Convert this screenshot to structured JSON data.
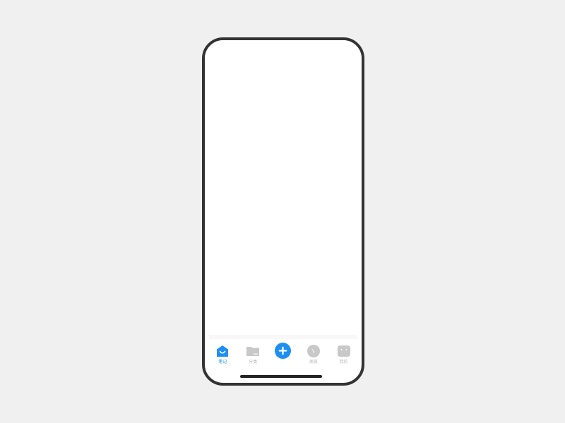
{
  "colors": {
    "background": "#f0f0f0",
    "phone_frame": "#333333",
    "screen": "#ffffff",
    "accent": "#1e8ff2",
    "inactive": "#c8c8c8",
    "home_indicator": "#222222"
  },
  "tabbar": {
    "items": [
      {
        "label": "笔记",
        "icon": "home-icon",
        "active": true
      },
      {
        "label": "分类",
        "icon": "folder-icon",
        "active": false
      },
      {
        "label": "",
        "icon": "add-icon",
        "active": false
      },
      {
        "label": "发现",
        "icon": "compass-icon",
        "active": false
      },
      {
        "label": "我的",
        "icon": "profile-icon",
        "active": false
      }
    ]
  }
}
